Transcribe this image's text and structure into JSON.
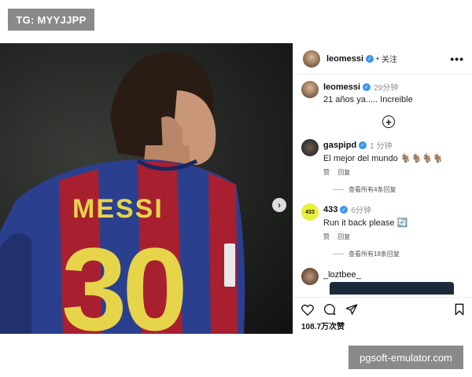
{
  "watermarks": {
    "top": "TG: MYYJJPP",
    "bottom": "pgsoft-emulator.com"
  },
  "photo": {
    "jersey_name": "MESSI",
    "jersey_number": "30"
  },
  "header": {
    "username": "leomessi",
    "separator": "•",
    "follow_label": "关注",
    "more_label": "•••"
  },
  "caption": {
    "username": "leomessi",
    "time": "29分钟",
    "text": "21 años ya..... Increible"
  },
  "comments": [
    {
      "username": "gaspipd",
      "time": "1 分钟",
      "text": "El mejor del mundo 🐐🐐🐐🐐",
      "like_label": "赞",
      "reply_label": "回复",
      "view_replies": "查看所有4条回复"
    },
    {
      "username": "433",
      "avatar_text": "433",
      "time": "6分钟",
      "text": "Run it back please 🔄",
      "like_label": "赞",
      "reply_label": "回复",
      "view_replies": "查看所有18条回复"
    },
    {
      "username": "_loztbee_"
    }
  ],
  "actions": {
    "likes": "108.7万次赞"
  },
  "colors": {
    "verified": "#3897f0",
    "jersey_blue": "#2b3f8f",
    "jersey_red": "#a8202f",
    "text_yellow": "#e6d44a"
  },
  "icons": [
    "heart-icon",
    "comment-icon",
    "share-icon",
    "bookmark-icon",
    "add-comment-icon",
    "chevron-right-icon"
  ]
}
